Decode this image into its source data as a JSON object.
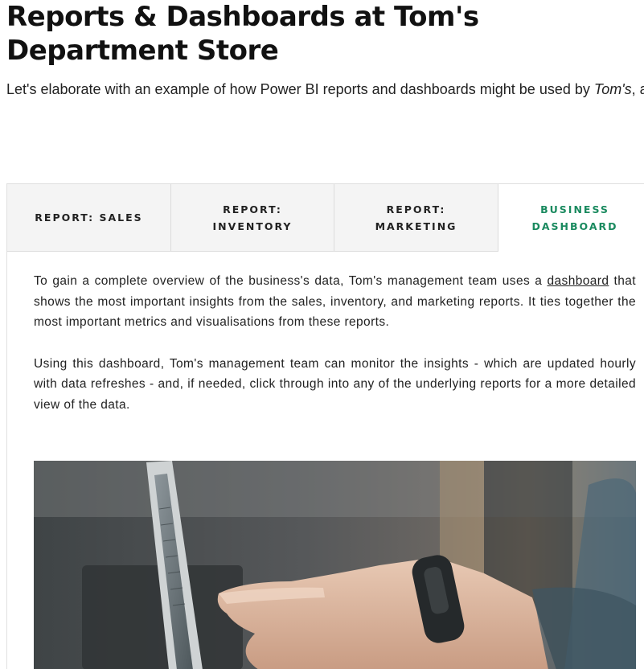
{
  "heading": "Reports & Dashboards at Tom's Department Store",
  "intro": {
    "before": "Let's elaborate with an example of how Power BI reports and dashboards might be used by ",
    "emphasis": "Tom's",
    "after": ", a department store with multiple store locations."
  },
  "tabs": [
    {
      "label": "REPORT: SALES",
      "active": false
    },
    {
      "label": "REPORT: INVENTORY",
      "active": false
    },
    {
      "label": "REPORT: MARKETING",
      "active": false
    },
    {
      "label": "BUSINESS DASHBOARD",
      "active": true
    }
  ],
  "panel": {
    "paragraph1_before": "To gain a complete overview of the business's data, Tom's management team uses a ",
    "paragraph1_link": "dashboard",
    "paragraph1_after": " that shows the most important insights from the sales, inventory, and marketing reports. It ties together the most important metrics and visualisations from these reports.",
    "paragraph2": "Using this dashboard, Tom's management team can monitor the insights - which are updated hourly with data refreshes - and, if needed, click through into any of the underlying reports for a more detailed view of the data."
  },
  "colors": {
    "active_tab_text": "#1a8a5f",
    "tab_background": "#f4f4f4"
  }
}
